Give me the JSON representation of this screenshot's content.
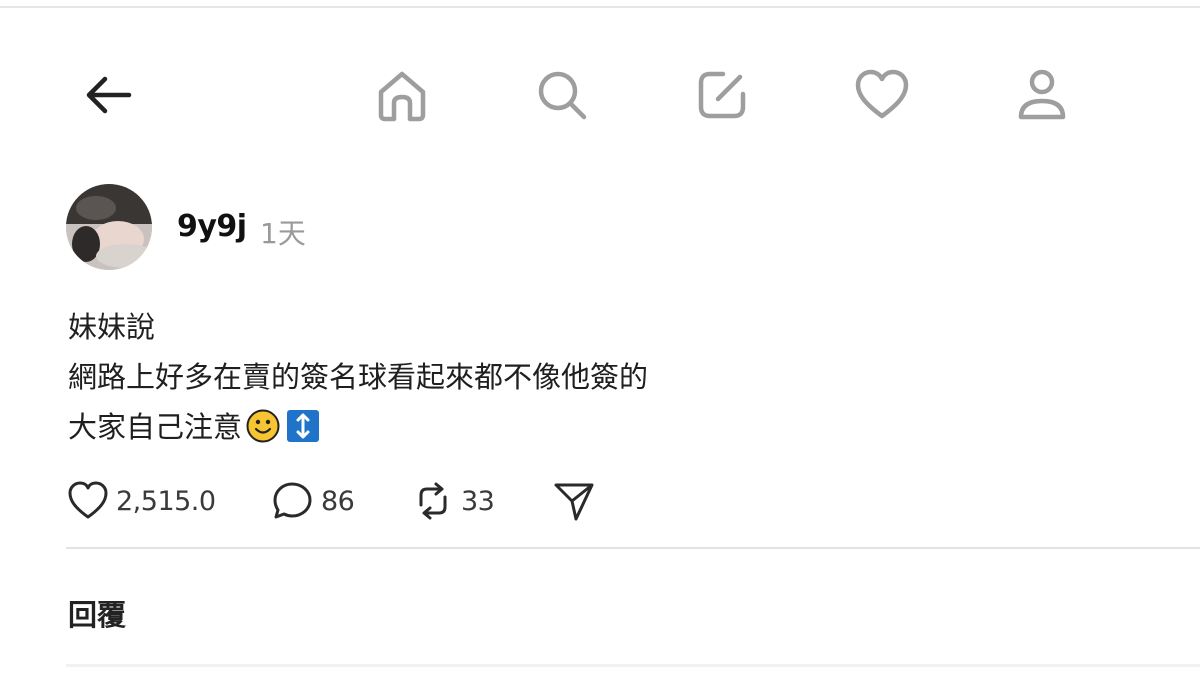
{
  "nav": {
    "back_icon": "arrow-left-icon",
    "items": [
      {
        "icon": "home-icon"
      },
      {
        "icon": "search-icon"
      },
      {
        "icon": "compose-icon"
      },
      {
        "icon": "heart-icon"
      },
      {
        "icon": "profile-icon"
      }
    ]
  },
  "post": {
    "username": "9y9j",
    "timestamp": "1天",
    "lines": [
      "妹妹說",
      "網路上好多在賣的簽名球看起來都不像他簽的",
      "大家自己注意"
    ],
    "emojis": [
      "slightly-smiling-face",
      "up-down-arrow"
    ],
    "likes": "2,515.0",
    "comments": "86",
    "reposts": "33"
  },
  "replies_label": "回覆",
  "colors": {
    "icon_gray": "#9e9e9e",
    "text": "#1f1f1f",
    "muted": "#9a9a9a",
    "emoji_yellow": "#f7c531",
    "emoji_blue": "#1f74c9"
  }
}
